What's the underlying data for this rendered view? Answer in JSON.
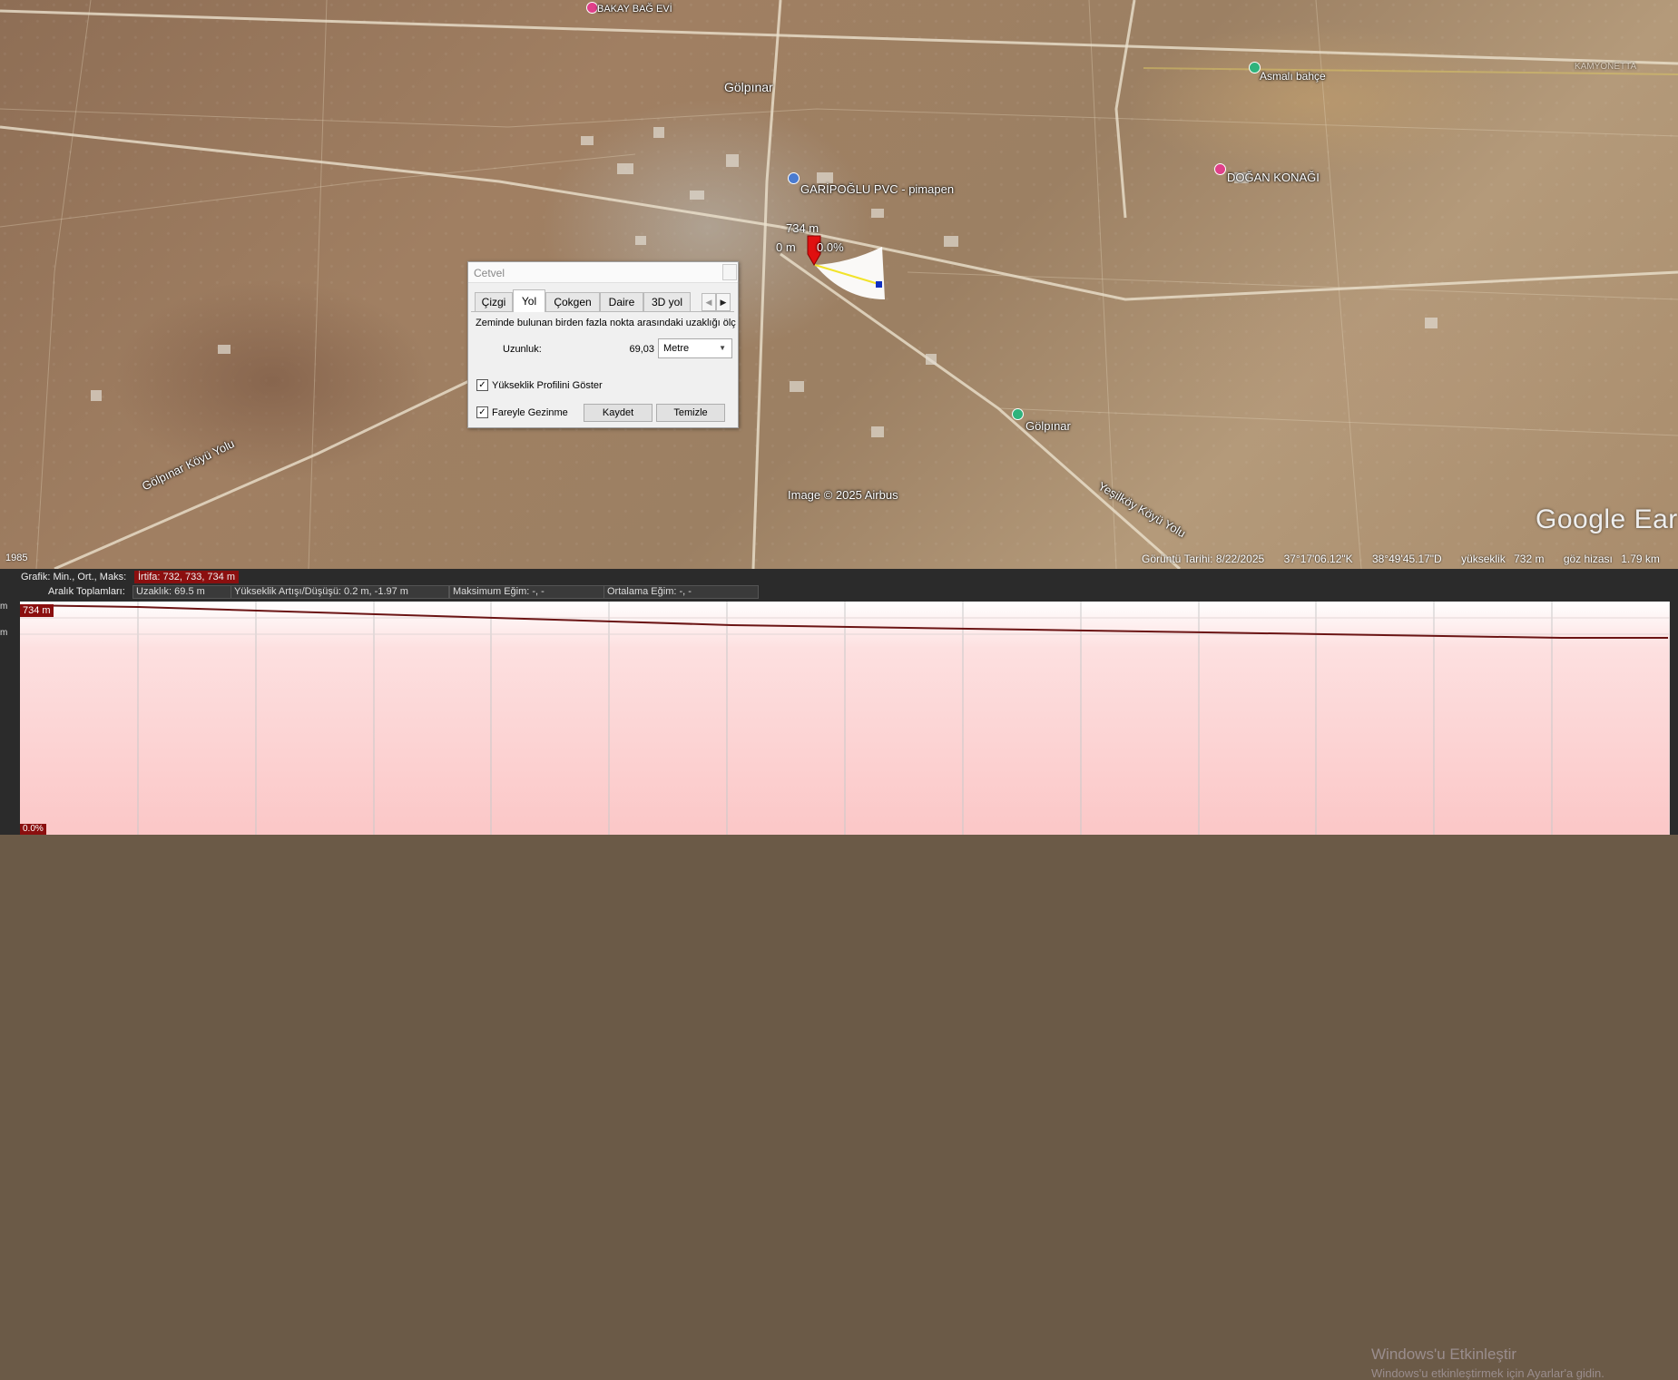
{
  "map": {
    "labels": {
      "bakay_bag_evi": "BAKAY BAĞ EVİ",
      "golpinar_village": "Gölpınar",
      "garipoglu": "GARİPOĞLU PVC - pimapen",
      "dogan_konagi": "DOĞAN KONAĞI",
      "asmali_bahce": "Asmalı bahçe",
      "golpinar_poi": "Gölpınar",
      "golpinar_koyu_yolu": "Gölpınar Köyü Yolu",
      "yesilkoy_koyu_yolu": "Yeşilköy Köyü Yolu",
      "image_credit": "Image © 2025 Airbus",
      "top_right_faded": "KAMYONETTA",
      "elev_marker": "734 m",
      "start_label": "0 m",
      "grade_label": "0.0%"
    },
    "google_logo": "Google Ear",
    "year": "1985",
    "status": {
      "date": "Görüntü Tarihi: 8/22/2025",
      "lat": "37°17'06.12\"K",
      "lon": "38°49'45.17\"D",
      "elev_label": "yükseklik",
      "elev_value": "732 m",
      "eye_label": "göz hizası",
      "eye_value": "1.79 km"
    },
    "icons": [
      "pink-pin-icon",
      "green-pin-icon",
      "blue-pin-icon",
      "red-marker-icon"
    ]
  },
  "ruler": {
    "title": "Cetvel",
    "tabs": [
      "Çizgi",
      "Yol",
      "Çokgen",
      "Daire",
      "3D yol"
    ],
    "active_tab": "Yol",
    "description": "Zeminde bulunan birden fazla nokta arasındaki uzaklığı ölç",
    "length_label": "Uzunluk:",
    "length_value": "69,03",
    "unit": "Metre",
    "show_elevation_label": "Yükseklik Profilini Göster",
    "show_elevation_checked": true,
    "mouse_nav_label": "Fareyle Gezinme",
    "mouse_nav_checked": true,
    "save_button": "Kaydet",
    "clear_button": "Temizle"
  },
  "profile": {
    "graph_label": "Grafik: Min., Ort., Maks:",
    "elevation_stats": "İrtifa: 732, 733, 734 m",
    "range_totals_label": "Aralık Toplamları:",
    "distance": "Uzaklık: 69.5 m",
    "elev_gain_loss": "Yükseklik Artışı/Düşüşü: 0.2 m, -1.97 m",
    "max_slope": "Maksimum Eğim: -, -",
    "avg_slope": "Ortalama Eğim: -, -",
    "top_tag": "734 m",
    "bottom_tag": "0.0%",
    "left_tick_1": "m",
    "left_tick_2": "m"
  },
  "chart_data": {
    "type": "line",
    "x": [
      0,
      5,
      10,
      15,
      20,
      25,
      30,
      35,
      40,
      45,
      50,
      55,
      60,
      65,
      69.5
    ],
    "values": [
      734.0,
      733.9,
      733.7,
      733.5,
      733.3,
      733.1,
      732.9,
      732.8,
      732.7,
      732.6,
      732.5,
      732.4,
      732.3,
      732.2,
      732.2
    ],
    "ylim": [
      732,
      734
    ],
    "grid": true
  },
  "windows": {
    "activate_title": "Windows'u Etkinleştir",
    "activate_sub": "Windows'u etkinleştirmek için Ayarlar'a gidin."
  }
}
